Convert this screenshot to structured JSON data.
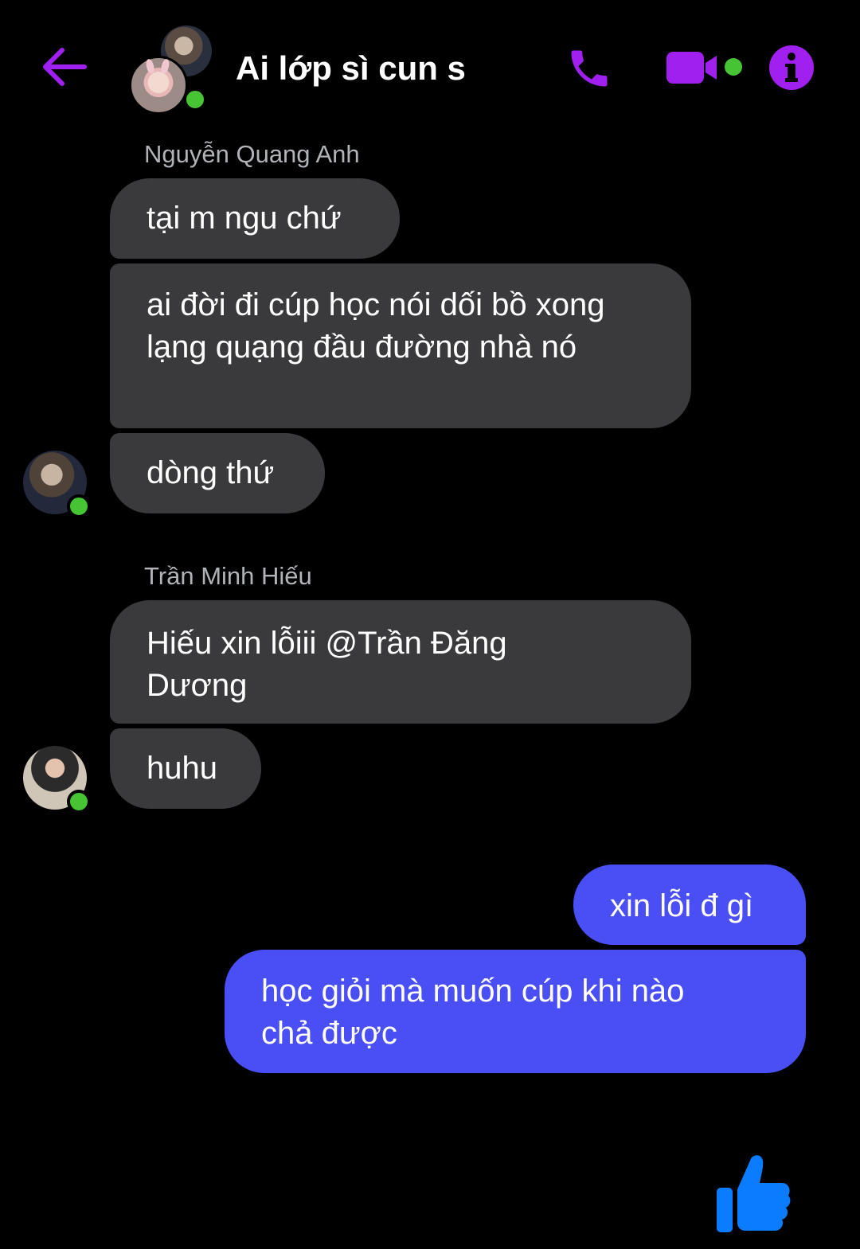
{
  "header": {
    "title": "Ai lớp sì cun s",
    "accent_color": "#a020f0",
    "online_color": "#46c434",
    "icons": [
      "back-arrow-icon",
      "phone-icon",
      "video-camera-icon",
      "info-icon"
    ]
  },
  "messages": {
    "group1": {
      "sender": "Nguyễn Quang Anh",
      "m1": "tại m ngu chứ",
      "m2": "ai đời đi cúp học nói dối bồ xong lạng quạng đầu đường nhà nó",
      "m3": "dòng thứ"
    },
    "group2": {
      "sender": "Trần Minh Hiếu",
      "m1": "Hiếu xin lỗiii @Trần Đăng Dương",
      "m2": "huhu"
    },
    "own": {
      "m1": "xin lỗi đ gì",
      "m2": "học giỏi mà muốn cúp khi nào chả được"
    }
  },
  "colors": {
    "incoming_bubble": "#3a3a3c",
    "outgoing_bubble": "#4a4ef5",
    "like_icon": "#0a7cff"
  },
  "footer": {
    "like_icon": "thumbs-up-icon"
  }
}
